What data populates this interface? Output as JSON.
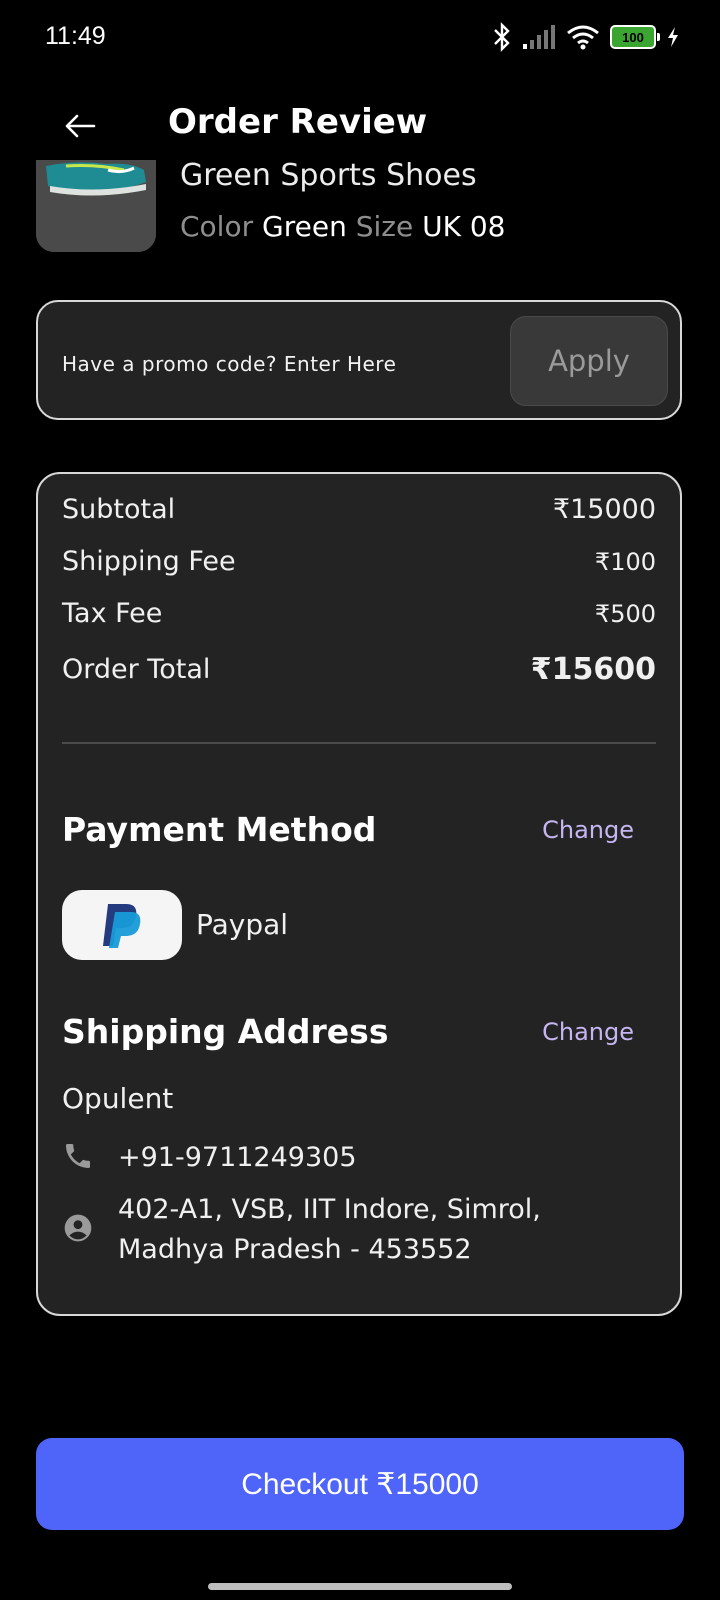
{
  "status_bar": {
    "time": "11:49",
    "battery_level": "100",
    "icons": [
      "bluetooth-icon",
      "signal-icon",
      "wifi-icon",
      "battery-icon",
      "charging-icon"
    ]
  },
  "header": {
    "title": "Order Review",
    "back_icon": "arrow-left-icon"
  },
  "product": {
    "name": "Green Sports Shoes",
    "color_label": "Color",
    "color_value": "Green",
    "size_label": "Size",
    "size_value": "UK 08"
  },
  "promo": {
    "placeholder": "Have a promo code? Enter Here",
    "apply_label": "Apply"
  },
  "summary": {
    "subtotal_label": "Subtotal",
    "subtotal_value": "₹15000",
    "shipping_label": "Shipping Fee",
    "shipping_value": "₹100",
    "tax_label": "Tax Fee",
    "tax_value": "₹500",
    "total_label": "Order Total",
    "total_value": "₹15600"
  },
  "payment": {
    "title": "Payment Method",
    "change_label": "Change",
    "method_name": "Paypal",
    "logo_icon": "paypal-logo-icon"
  },
  "shipping": {
    "title": "Shipping Address",
    "change_label": "Change",
    "name": "Opulent",
    "phone": "+91-9711249305",
    "address_line1": "402-A1, VSB, IIT Indore, Simrol,",
    "address_line2": "Madhya Pradesh - 453552"
  },
  "checkout": {
    "label": "Checkout ₹15000"
  },
  "colors": {
    "background": "#000000",
    "card": "#232323",
    "accent": "#4f65fa",
    "link": "#c5b6f2",
    "battery": "#3aa531"
  }
}
